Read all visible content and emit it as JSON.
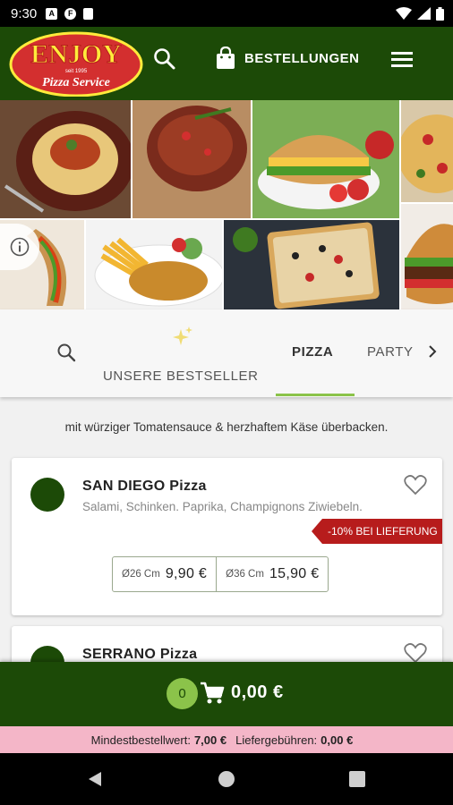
{
  "status_bar": {
    "time": "9:30",
    "icons": [
      "notification-a-icon",
      "notification-f-icon",
      "sd-card-icon",
      "wifi-icon",
      "signal-icon",
      "battery-icon"
    ],
    "icon_letters": [
      "A",
      "F"
    ]
  },
  "header": {
    "logo_text": "ENJOY",
    "logo_sub": "Pizza Service",
    "logo_since": "seit 1995",
    "orders_label": "BESTELLUNGEN",
    "colors": {
      "primary": "#1c4a07",
      "accent": "#8bc34a",
      "logo_red": "#d32f2f",
      "logo_yellow": "#ffeb3b"
    }
  },
  "tabs": {
    "bestseller_label": "UNSERE BESTSELLER",
    "items": [
      "PIZZA",
      "PARTY"
    ],
    "active": "PIZZA"
  },
  "category_description": "mit würziger Tomatensauce & herzhaftem Käse überbacken.",
  "products": [
    {
      "name": "SAN DIEGO Pizza",
      "ingredients": "Salami, Schinken. Paprika, Champignons Ziwiebeln.",
      "badge": "-10% BEI LIEFERUNG",
      "prices": [
        {
          "size": "Ø26 Cm",
          "price": "9,90 €"
        },
        {
          "size": "Ø36 Cm",
          "price": "15,90 €"
        }
      ]
    },
    {
      "name": "SERRANO Pizza"
    }
  ],
  "cart": {
    "count": "0",
    "total": "0,00 €"
  },
  "footer": {
    "min_order_label": "Mindestbestellwert:",
    "min_order_value": "7,00 €",
    "delivery_label": "Liefergebühren:",
    "delivery_value": "0,00 €"
  }
}
